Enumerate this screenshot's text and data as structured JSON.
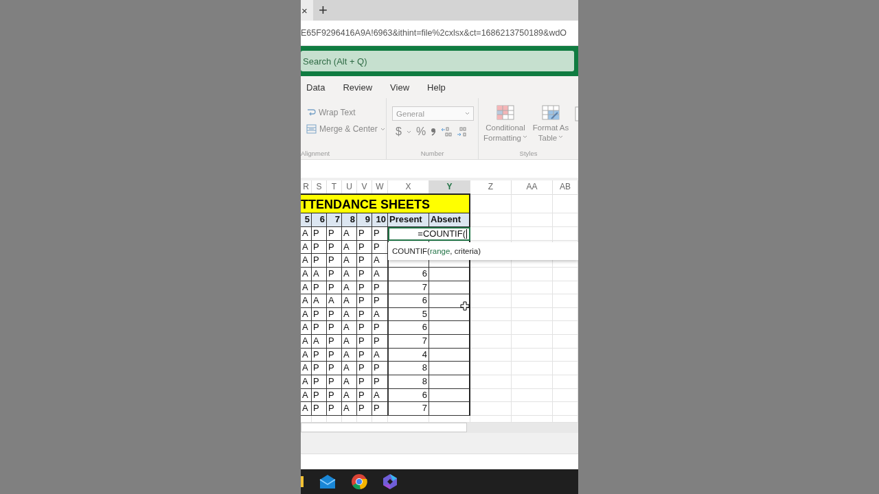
{
  "browser": {
    "close_tab": "×",
    "new_tab": "+",
    "address": "E65F9296416A9A!6963&ithint=file%2cxlsx&ct=1686213750189&wdO"
  },
  "search": {
    "placeholder": "Search (Alt + Q)"
  },
  "menu": [
    {
      "label": "Data"
    },
    {
      "label": "Review"
    },
    {
      "label": "View"
    },
    {
      "label": "Help"
    }
  ],
  "ribbon": {
    "alignment": {
      "label": "Alignment",
      "wrap": "Wrap Text",
      "merge": "Merge & Center"
    },
    "number": {
      "label": "Number",
      "format": "General",
      "currency": "$",
      "percent": "%"
    },
    "styles": {
      "label": "Styles",
      "commands": [
        {
          "line1": "Conditional",
          "line2": "Formatting"
        },
        {
          "line1": "Format As",
          "line2": "Table"
        }
      ]
    }
  },
  "sheet": {
    "columns": [
      {
        "label": "R",
        "selected": false
      },
      {
        "label": "S",
        "selected": false
      },
      {
        "label": "T",
        "selected": false
      },
      {
        "label": "U",
        "selected": false
      },
      {
        "label": "V",
        "selected": false
      },
      {
        "label": "W",
        "selected": false
      },
      {
        "label": "X",
        "selected": false
      },
      {
        "label": "Y",
        "selected": true
      },
      {
        "label": "Z",
        "selected": false
      },
      {
        "label": "AA",
        "selected": false
      },
      {
        "label": "AB",
        "selected": false
      }
    ],
    "title": "TTENDANCE SHEETS",
    "day_headers": [
      "5",
      "6",
      "7",
      "8",
      "9",
      "10"
    ],
    "present_header": "Present",
    "absent_header": "Absent",
    "rows": [
      {
        "active": true,
        "cells": [
          "A",
          "P",
          "P",
          "A",
          "P",
          "P"
        ],
        "present": "=COUNTIF("
      },
      {
        "active": false,
        "cells": [
          "A",
          "P",
          "P",
          "A",
          "P",
          "P"
        ]
      },
      {
        "active": false,
        "cells": [
          "A",
          "P",
          "P",
          "A",
          "P",
          "A"
        ]
      },
      {
        "active": false,
        "cells": [
          "A",
          "A",
          "P",
          "A",
          "P",
          "A"
        ],
        "present": "6"
      },
      {
        "active": false,
        "cells": [
          "A",
          "P",
          "P",
          "A",
          "P",
          "P"
        ],
        "present": "7"
      },
      {
        "active": false,
        "cells": [
          "A",
          "A",
          "A",
          "A",
          "P",
          "P"
        ],
        "present": "6"
      },
      {
        "active": false,
        "cells": [
          "A",
          "P",
          "P",
          "A",
          "P",
          "A"
        ],
        "present": "5"
      },
      {
        "active": false,
        "cells": [
          "A",
          "P",
          "P",
          "A",
          "P",
          "P"
        ],
        "present": "6"
      },
      {
        "active": false,
        "cells": [
          "A",
          "A",
          "P",
          "A",
          "P",
          "P"
        ],
        "present": "7"
      },
      {
        "active": false,
        "cells": [
          "A",
          "P",
          "P",
          "A",
          "P",
          "A"
        ],
        "present": "4"
      },
      {
        "active": false,
        "cells": [
          "A",
          "P",
          "P",
          "A",
          "P",
          "P"
        ],
        "present": "8"
      },
      {
        "active": false,
        "cells": [
          "A",
          "P",
          "P",
          "A",
          "P",
          "P"
        ],
        "present": "8"
      },
      {
        "active": false,
        "cells": [
          "A",
          "P",
          "P",
          "A",
          "P",
          "A"
        ],
        "present": "6"
      },
      {
        "active": false,
        "cells": [
          "A",
          "P",
          "P",
          "A",
          "P",
          "P"
        ],
        "present": "7"
      }
    ]
  },
  "tooltip": "COUNTIF(**range**, criteria)"
}
